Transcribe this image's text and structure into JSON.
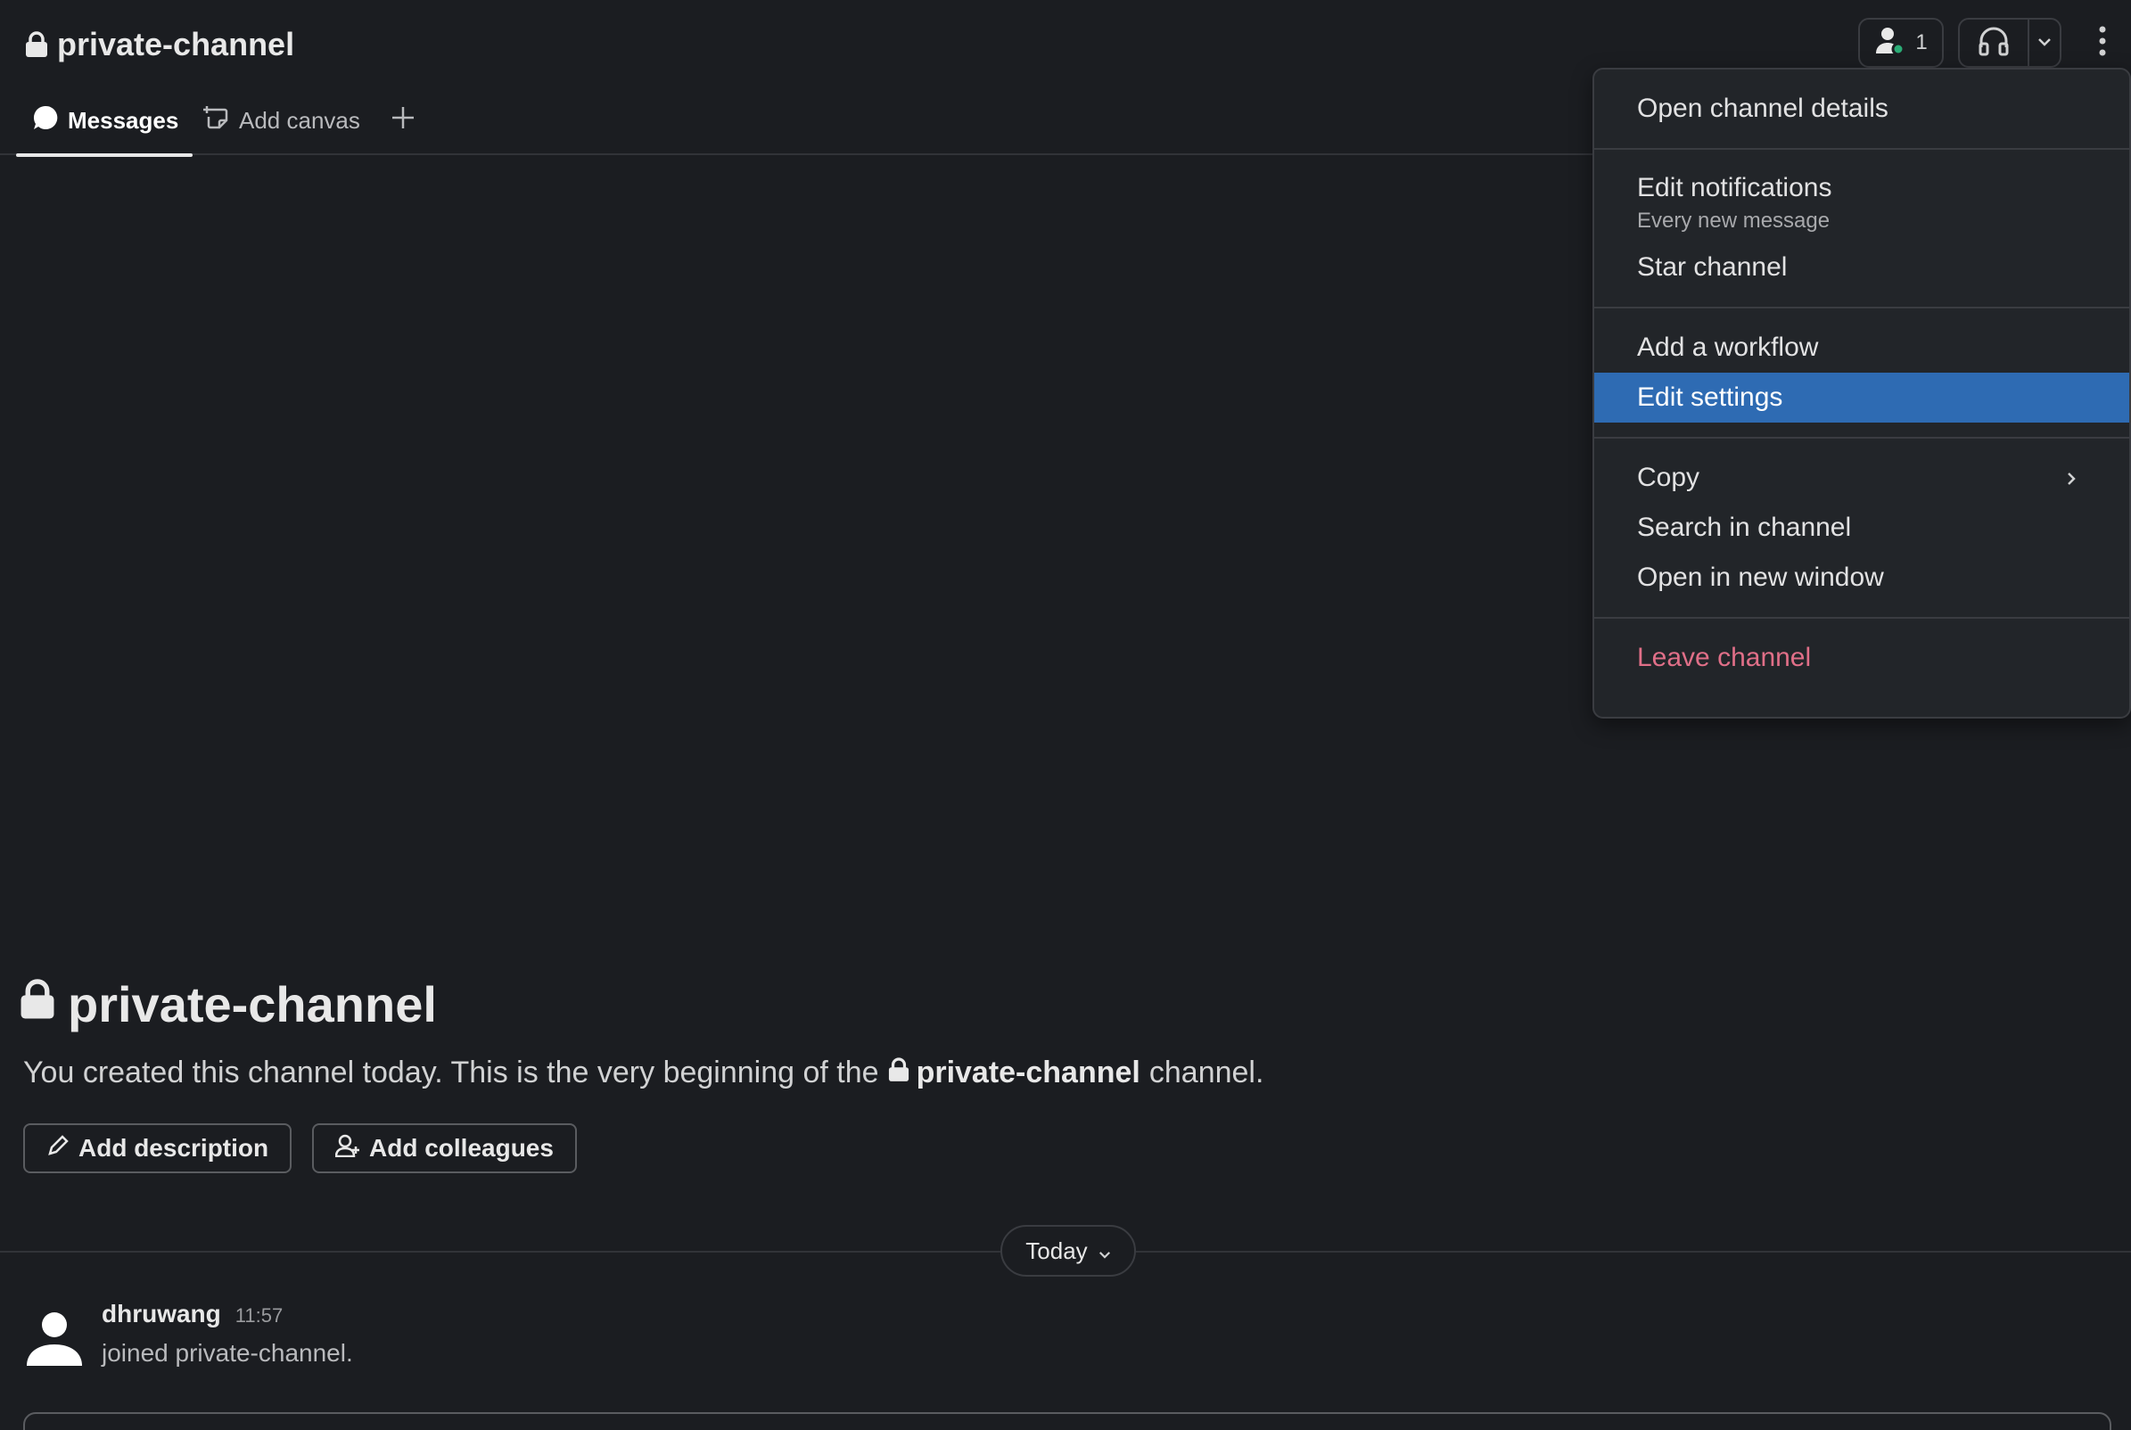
{
  "header": {
    "channel_name": "private-channel",
    "member_count": "1"
  },
  "tabs": [
    {
      "label": "Messages"
    },
    {
      "label": "Add canvas"
    }
  ],
  "intro": {
    "title": "private-channel",
    "text_before": "You created this channel today. This is the very beginning of the",
    "channel_name": "private-channel",
    "text_after": "channel.",
    "add_description_label": "Add description",
    "add_colleagues_label": "Add colleagues"
  },
  "divider": {
    "label": "Today"
  },
  "message": {
    "author": "dhruwang",
    "time": "11:57",
    "text": "joined private-channel."
  },
  "menu": {
    "open_details": "Open channel details",
    "edit_notifications": "Edit notifications",
    "edit_notifications_sub": "Every new message",
    "star_channel": "Star channel",
    "add_workflow": "Add a workflow",
    "edit_settings": "Edit settings",
    "copy": "Copy",
    "search_in_channel": "Search in channel",
    "open_new_window": "Open in new window",
    "leave_channel": "Leave channel"
  },
  "colors": {
    "background": "#1b1d21",
    "menu_highlight": "#2e6bb3",
    "danger": "#e06f88",
    "presence": "#2bac76"
  },
  "icons": [
    "lock-icon",
    "person-icon",
    "headphones-icon",
    "chevron-down-icon",
    "kebab-icon",
    "message-bubble-icon",
    "canvas-icon",
    "plus-icon",
    "pencil-icon",
    "add-person-icon",
    "chevron-right-icon",
    "avatar"
  ]
}
